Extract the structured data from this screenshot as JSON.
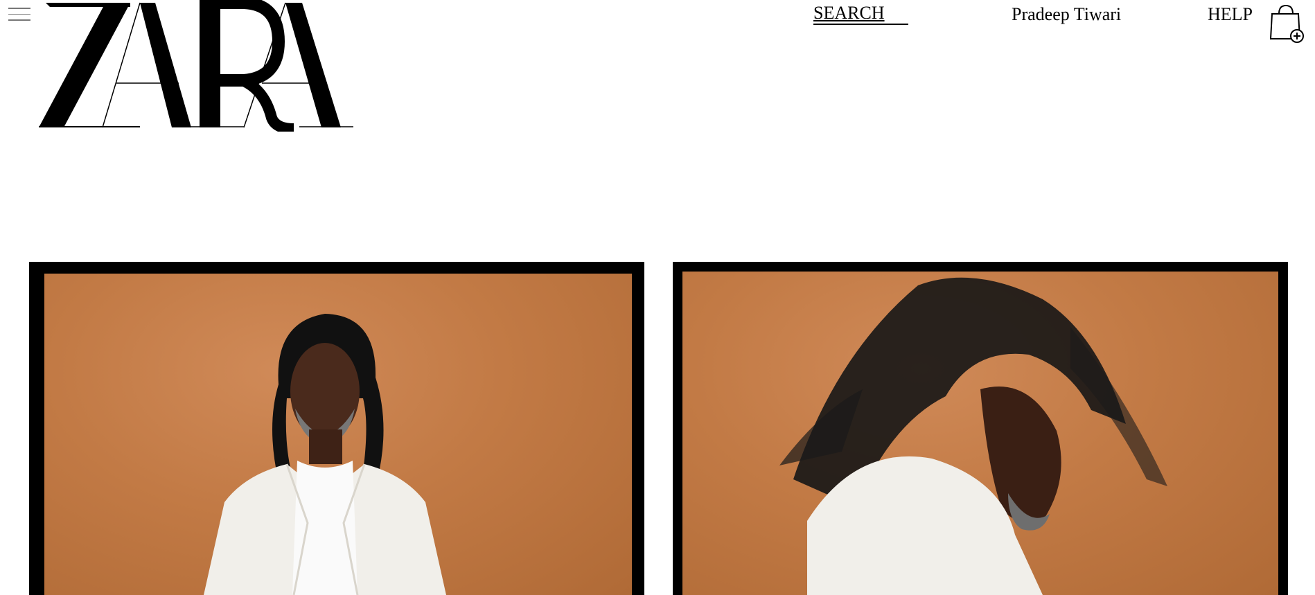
{
  "header": {
    "menu_icon": "hamburger-icon",
    "logo_text": "ZARA",
    "search_label": "SEARCH",
    "user_name": "Pradeep Tiwari",
    "help_label": "HELP",
    "bag_icon": "shopping-bag-plus-icon"
  },
  "hero": {
    "panels": [
      {
        "id": "left",
        "subject": "portrait-front"
      },
      {
        "id": "right",
        "subject": "portrait-motion-blur"
      }
    ]
  },
  "colors": {
    "background": "#ffffff",
    "text": "#000000",
    "photo_backdrop": "#c27a45",
    "frame": "#000000",
    "jacket": "#f1efea"
  }
}
